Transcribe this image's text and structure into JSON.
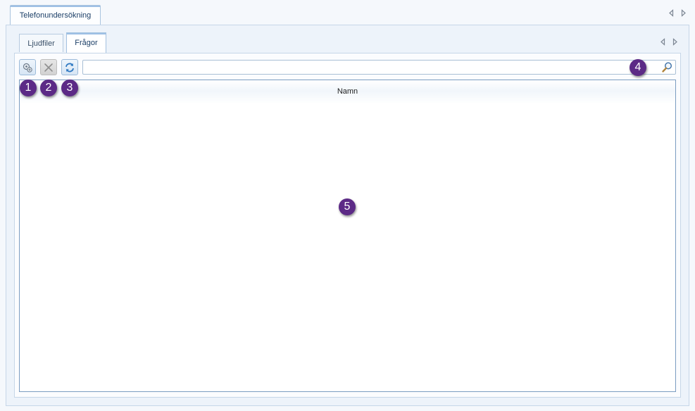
{
  "outer_tabs": {
    "active_label": "Telefonundersökning"
  },
  "inner_tabs": {
    "items": [
      {
        "label": "Ljudfiler"
      },
      {
        "label": "Frågor"
      }
    ],
    "active": "Frågor"
  },
  "toolbar": {
    "add_icon": "add-question-icon",
    "delete_icon": "delete-icon",
    "refresh_icon": "refresh-icon"
  },
  "search": {
    "value": "",
    "placeholder": "",
    "icon": "search-icon"
  },
  "grid": {
    "columns": [
      {
        "header": "Namn"
      }
    ],
    "rows": []
  },
  "callouts": {
    "c1": "1",
    "c2": "2",
    "c3": "3",
    "c4": "4",
    "c5": "5"
  },
  "colors": {
    "callout": "#5c2a86",
    "accent": "#9ec0e5",
    "grid_border": "#7a9cc0"
  }
}
